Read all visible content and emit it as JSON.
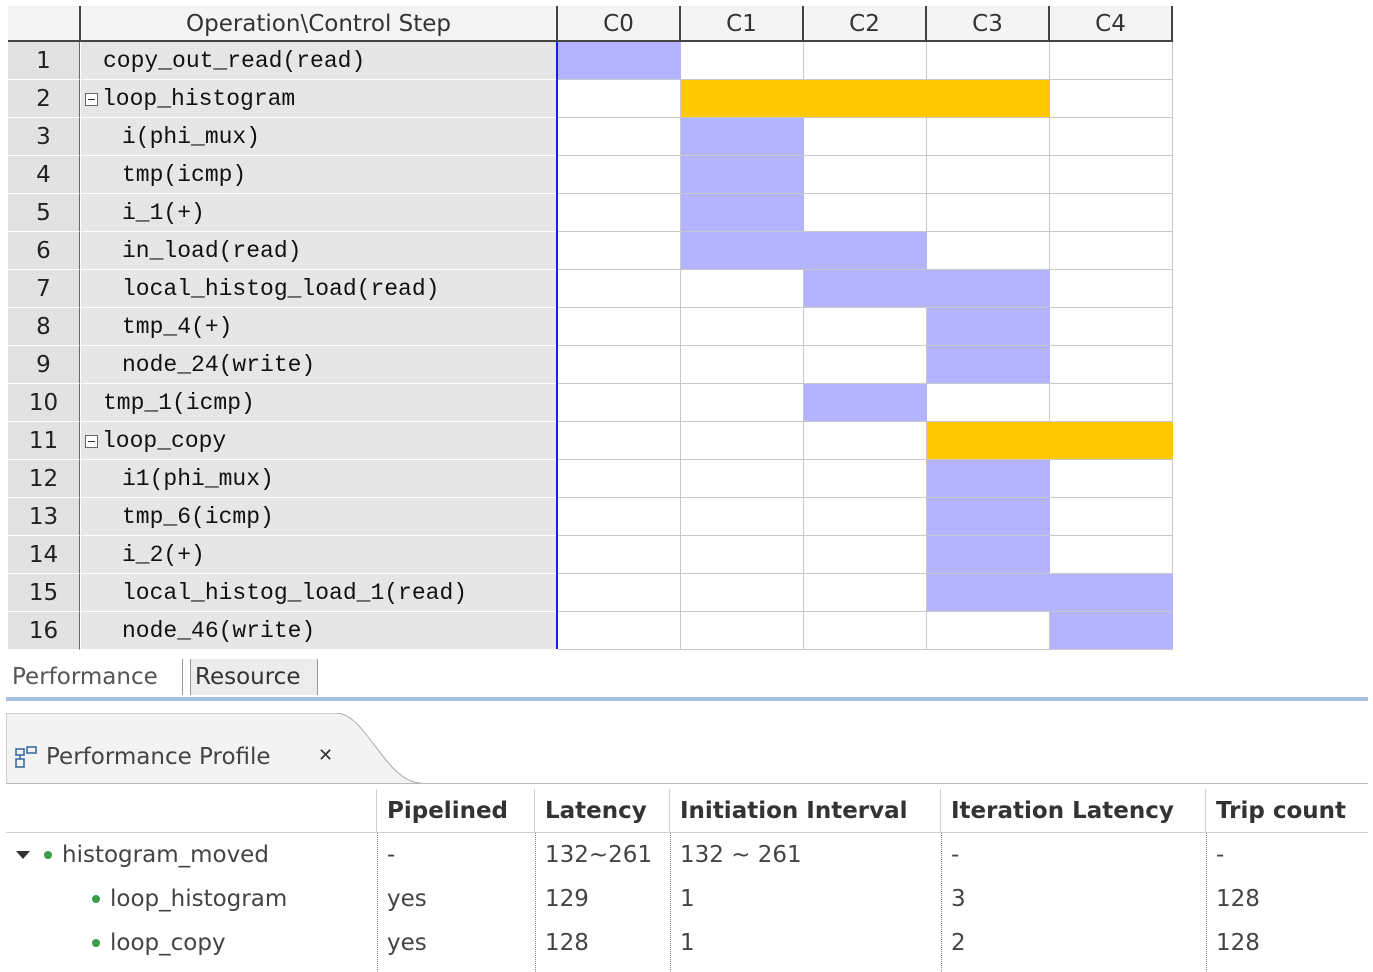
{
  "schedule": {
    "header": {
      "operation_col": "Operation\\Control Step",
      "steps": [
        "C0",
        "C1",
        "C2",
        "C3",
        "C4"
      ]
    },
    "rows": [
      {
        "num": "1",
        "name": "copy_out_read(read)",
        "indent": 1,
        "type": "op",
        "span": [
          0,
          0
        ]
      },
      {
        "num": "2",
        "name": "loop_histogram",
        "indent": 0,
        "type": "loop",
        "span": [
          1,
          3
        ],
        "expander": true
      },
      {
        "num": "3",
        "name": "i(phi_mux)",
        "indent": 2,
        "type": "op",
        "span": [
          1,
          1
        ]
      },
      {
        "num": "4",
        "name": "tmp(icmp)",
        "indent": 2,
        "type": "op",
        "span": [
          1,
          1
        ]
      },
      {
        "num": "5",
        "name": "i_1(+)",
        "indent": 2,
        "type": "op",
        "span": [
          1,
          1
        ]
      },
      {
        "num": "6",
        "name": "in_load(read)",
        "indent": 2,
        "type": "op",
        "span": [
          1,
          2
        ]
      },
      {
        "num": "7",
        "name": "local_histog_load(read)",
        "indent": 2,
        "type": "op",
        "span": [
          2,
          3
        ]
      },
      {
        "num": "8",
        "name": "tmp_4(+)",
        "indent": 2,
        "type": "op",
        "span": [
          3,
          3
        ]
      },
      {
        "num": "9",
        "name": "node_24(write)",
        "indent": 2,
        "type": "op",
        "span": [
          3,
          3
        ]
      },
      {
        "num": "10",
        "name": "tmp_1(icmp)",
        "indent": 1,
        "type": "op",
        "span": [
          2,
          2
        ]
      },
      {
        "num": "11",
        "name": "loop_copy",
        "indent": 0,
        "type": "loop",
        "span": [
          3,
          4
        ],
        "expander": true
      },
      {
        "num": "12",
        "name": "i1(phi_mux)",
        "indent": 2,
        "type": "op",
        "span": [
          3,
          3
        ]
      },
      {
        "num": "13",
        "name": "tmp_6(icmp)",
        "indent": 2,
        "type": "op",
        "span": [
          3,
          3
        ]
      },
      {
        "num": "14",
        "name": "i_2(+)",
        "indent": 2,
        "type": "op",
        "span": [
          3,
          3
        ]
      },
      {
        "num": "15",
        "name": "local_histog_load_1(read)",
        "indent": 2,
        "type": "op",
        "span": [
          3,
          4
        ]
      },
      {
        "num": "16",
        "name": "node_46(write)",
        "indent": 2,
        "type": "op",
        "span": [
          4,
          4
        ]
      }
    ],
    "colors": {
      "op": "#b3b3ff",
      "loop": "#ffc800",
      "cursor": "#1a1aff"
    }
  },
  "view_tabs": {
    "performance": "Performance",
    "resource": "Resource",
    "active": "performance"
  },
  "perf_view": {
    "title": "Performance Profile",
    "close_glyph": "✕",
    "icon": "performance-profile-icon"
  },
  "perf_table": {
    "columns": [
      "",
      "Pipelined",
      "Latency",
      "Initiation Interval",
      "Iteration Latency",
      "Trip count"
    ],
    "rows": [
      {
        "name": "histogram_moved",
        "expanded": true,
        "level": 0,
        "pipelined": "-",
        "latency": "132~261",
        "ii": "132 ~ 261",
        "iter_latency": "-",
        "trip_count": "-"
      },
      {
        "name": "loop_histogram",
        "level": 1,
        "pipelined": "yes",
        "latency": "129",
        "ii": "1",
        "iter_latency": "3",
        "trip_count": "128"
      },
      {
        "name": "loop_copy",
        "level": 1,
        "pipelined": "yes",
        "latency": "128",
        "ii": "1",
        "iter_latency": "2",
        "trip_count": "128"
      }
    ],
    "status_color": "#3a9b48"
  }
}
